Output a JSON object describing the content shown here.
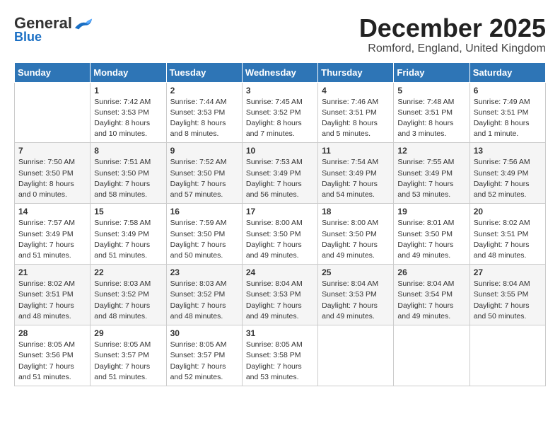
{
  "header": {
    "logo": {
      "general": "General",
      "blue": "Blue"
    },
    "title": "December 2025",
    "location": "Romford, England, United Kingdom"
  },
  "weekdays": [
    "Sunday",
    "Monday",
    "Tuesday",
    "Wednesday",
    "Thursday",
    "Friday",
    "Saturday"
  ],
  "weeks": [
    [
      {
        "day": "",
        "info": ""
      },
      {
        "day": "1",
        "info": "Sunrise: 7:42 AM\nSunset: 3:53 PM\nDaylight: 8 hours\nand 10 minutes."
      },
      {
        "day": "2",
        "info": "Sunrise: 7:44 AM\nSunset: 3:53 PM\nDaylight: 8 hours\nand 8 minutes."
      },
      {
        "day": "3",
        "info": "Sunrise: 7:45 AM\nSunset: 3:52 PM\nDaylight: 8 hours\nand 7 minutes."
      },
      {
        "day": "4",
        "info": "Sunrise: 7:46 AM\nSunset: 3:51 PM\nDaylight: 8 hours\nand 5 minutes."
      },
      {
        "day": "5",
        "info": "Sunrise: 7:48 AM\nSunset: 3:51 PM\nDaylight: 8 hours\nand 3 minutes."
      },
      {
        "day": "6",
        "info": "Sunrise: 7:49 AM\nSunset: 3:51 PM\nDaylight: 8 hours\nand 1 minute."
      }
    ],
    [
      {
        "day": "7",
        "info": "Sunrise: 7:50 AM\nSunset: 3:50 PM\nDaylight: 8 hours\nand 0 minutes."
      },
      {
        "day": "8",
        "info": "Sunrise: 7:51 AM\nSunset: 3:50 PM\nDaylight: 7 hours\nand 58 minutes."
      },
      {
        "day": "9",
        "info": "Sunrise: 7:52 AM\nSunset: 3:50 PM\nDaylight: 7 hours\nand 57 minutes."
      },
      {
        "day": "10",
        "info": "Sunrise: 7:53 AM\nSunset: 3:49 PM\nDaylight: 7 hours\nand 56 minutes."
      },
      {
        "day": "11",
        "info": "Sunrise: 7:54 AM\nSunset: 3:49 PM\nDaylight: 7 hours\nand 54 minutes."
      },
      {
        "day": "12",
        "info": "Sunrise: 7:55 AM\nSunset: 3:49 PM\nDaylight: 7 hours\nand 53 minutes."
      },
      {
        "day": "13",
        "info": "Sunrise: 7:56 AM\nSunset: 3:49 PM\nDaylight: 7 hours\nand 52 minutes."
      }
    ],
    [
      {
        "day": "14",
        "info": "Sunrise: 7:57 AM\nSunset: 3:49 PM\nDaylight: 7 hours\nand 51 minutes."
      },
      {
        "day": "15",
        "info": "Sunrise: 7:58 AM\nSunset: 3:49 PM\nDaylight: 7 hours\nand 51 minutes."
      },
      {
        "day": "16",
        "info": "Sunrise: 7:59 AM\nSunset: 3:50 PM\nDaylight: 7 hours\nand 50 minutes."
      },
      {
        "day": "17",
        "info": "Sunrise: 8:00 AM\nSunset: 3:50 PM\nDaylight: 7 hours\nand 49 minutes."
      },
      {
        "day": "18",
        "info": "Sunrise: 8:00 AM\nSunset: 3:50 PM\nDaylight: 7 hours\nand 49 minutes."
      },
      {
        "day": "19",
        "info": "Sunrise: 8:01 AM\nSunset: 3:50 PM\nDaylight: 7 hours\nand 49 minutes."
      },
      {
        "day": "20",
        "info": "Sunrise: 8:02 AM\nSunset: 3:51 PM\nDaylight: 7 hours\nand 48 minutes."
      }
    ],
    [
      {
        "day": "21",
        "info": "Sunrise: 8:02 AM\nSunset: 3:51 PM\nDaylight: 7 hours\nand 48 minutes."
      },
      {
        "day": "22",
        "info": "Sunrise: 8:03 AM\nSunset: 3:52 PM\nDaylight: 7 hours\nand 48 minutes."
      },
      {
        "day": "23",
        "info": "Sunrise: 8:03 AM\nSunset: 3:52 PM\nDaylight: 7 hours\nand 48 minutes."
      },
      {
        "day": "24",
        "info": "Sunrise: 8:04 AM\nSunset: 3:53 PM\nDaylight: 7 hours\nand 49 minutes."
      },
      {
        "day": "25",
        "info": "Sunrise: 8:04 AM\nSunset: 3:53 PM\nDaylight: 7 hours\nand 49 minutes."
      },
      {
        "day": "26",
        "info": "Sunrise: 8:04 AM\nSunset: 3:54 PM\nDaylight: 7 hours\nand 49 minutes."
      },
      {
        "day": "27",
        "info": "Sunrise: 8:04 AM\nSunset: 3:55 PM\nDaylight: 7 hours\nand 50 minutes."
      }
    ],
    [
      {
        "day": "28",
        "info": "Sunrise: 8:05 AM\nSunset: 3:56 PM\nDaylight: 7 hours\nand 51 minutes."
      },
      {
        "day": "29",
        "info": "Sunrise: 8:05 AM\nSunset: 3:57 PM\nDaylight: 7 hours\nand 51 minutes."
      },
      {
        "day": "30",
        "info": "Sunrise: 8:05 AM\nSunset: 3:57 PM\nDaylight: 7 hours\nand 52 minutes."
      },
      {
        "day": "31",
        "info": "Sunrise: 8:05 AM\nSunset: 3:58 PM\nDaylight: 7 hours\nand 53 minutes."
      },
      {
        "day": "",
        "info": ""
      },
      {
        "day": "",
        "info": ""
      },
      {
        "day": "",
        "info": ""
      }
    ]
  ]
}
